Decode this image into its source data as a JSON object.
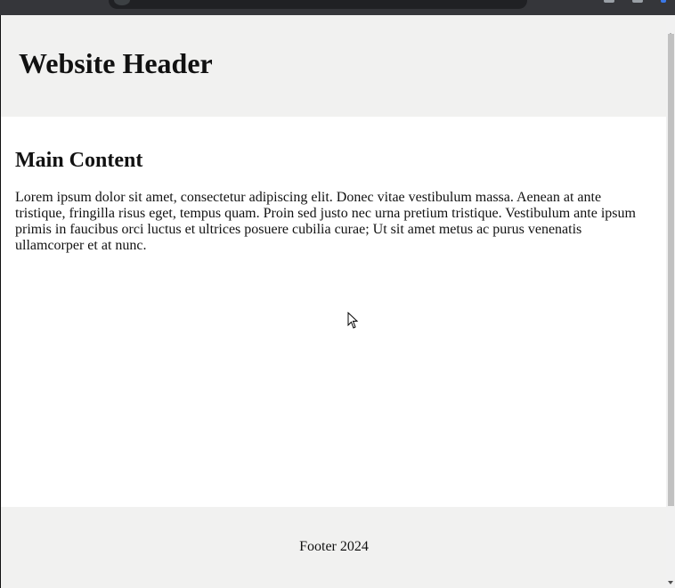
{
  "page": {
    "header_title": "Website Header",
    "main_heading": "Main Content",
    "main_paragraph": "Lorem ipsum dolor sit amet, consectetur adipiscing elit. Donec vitae vestibulum massa. Aenean at ante tristique, fringilla risus eget, tempus quam. Proin sed justo nec urna pretium tristique. Vestibulum ante ipsum primis in faucibus orci luctus et ultrices posuere cubilia curae; Ut sit amet metus ac purus venenatis ullamcorper et at nunc.",
    "footer_text": "Footer 2024"
  },
  "colors": {
    "header_bg": "#f1f1f0",
    "footer_bg": "#f1f1f0",
    "text": "#111111",
    "browser_chrome": "#35363a"
  },
  "icons": [
    "address-bar-icon",
    "toolbar-icon",
    "extension-icon",
    "mouse-cursor-icon",
    "scroll-up-arrow-icon",
    "scroll-down-arrow-icon"
  ]
}
